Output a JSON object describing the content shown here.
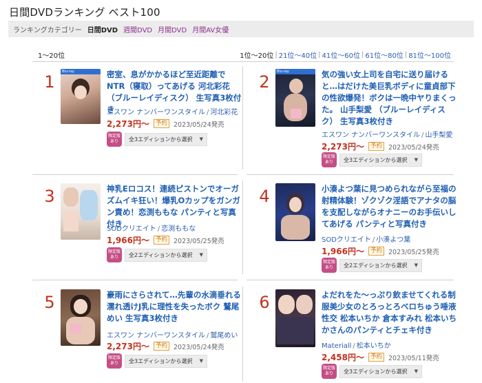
{
  "page": {
    "title": "日間DVDランキング ベスト100"
  },
  "categories": {
    "label": "ランキングカテゴリー",
    "active": "日間DVD",
    "links": [
      "週間DVD",
      "月間DVD",
      "月間AV女優"
    ]
  },
  "range": {
    "current": "1〜20位",
    "active": "1位〜20位",
    "links": [
      "21位〜40位",
      "41位〜60位",
      "61位〜80位",
      "81位〜100位"
    ]
  },
  "items": [
    {
      "rank": "1",
      "title": "密室、息がかかるほど至近距離でNTR（寝取）ってあげる 河北彩花 （ブルーレイディスク） 生写真3枚付き",
      "maker": "エスワン ナンバーワンスタイル",
      "actress": "河北彩花",
      "price": "2,273円〜",
      "yoyaku": "予約",
      "date": "2023/05/24発売",
      "badge": "限定版あり",
      "edition": "全3エディションから選択"
    },
    {
      "rank": "2",
      "title": "気の強い女上司を自宅に送り届けると…はだけた美巨乳ボディに童貞部下の性欲爆発！ボクは一晩中ヤりまくった。 山手梨愛 （ブルーレイディスク） 生写真3枚付き",
      "maker": "エスワン ナンバーワンスタイル",
      "actress": "山手梨愛",
      "price": "2,273円〜",
      "yoyaku": "予約",
      "date": "2023/05/24発売",
      "badge": "限定版あり",
      "edition": "全3エディションから選択"
    },
    {
      "rank": "3",
      "title": "神乳Eロコス！連続ピストンでオーガズムイキ狂い！爆乳Oカップをガンガン責め！恋渕ももな パンティと写真付き",
      "maker": "SODクリエイト",
      "actress": "恋渕ももな",
      "price": "1,966円〜",
      "yoyaku": "予約",
      "date": "2023/05/25発売",
      "badge": "限定版あり",
      "edition": "全2エディションから選択"
    },
    {
      "rank": "4",
      "title": "小湊よつ葉に見つめられながら至福の射精体験！ゾクゾク淫語でアナタの脳を支配しながらオナニーのお手伝いしてあげる パンティと写真付き",
      "maker": "SODクリエイト",
      "actress": "小湊よつ葉",
      "price": "1,966円〜",
      "yoyaku": "予約",
      "date": "2023/05/25発売",
      "badge": "限定版あり",
      "edition": "全2エディションから選択"
    },
    {
      "rank": "5",
      "title": "豪雨にさらされて…先輩の水滴垂れる濡れ透けJ乳に理性を失ったボク 鷲尾めい 生写真3枚付き",
      "maker": "エスワン ナンバーワンスタイル",
      "actress": "鷲尾めい",
      "price": "2,273円〜",
      "yoyaku": "予約",
      "date": "2023/05/24発売",
      "badge": "限定版あり",
      "edition": "全3エディションから選択"
    },
    {
      "rank": "6",
      "title": "よだれをた〜っぷり飲ませてくれる制服美少女のとろっとろベロちゅう唾液性交 松本いちか 倉本すみれ 松本いちかさんのパンティとチェキ付き",
      "maker": "Materiall",
      "actress": "松本いちか",
      "price": "2,458円〜",
      "yoyaku": "予約",
      "date": "2023/05/11発売",
      "badge": "限定版あり",
      "edition": "全3エディションから選択"
    }
  ],
  "colors": {
    "rank": "#c4301c",
    "title_link": "#1f5fb3",
    "category_link": "#8e2d8e",
    "badge": "#c44e86"
  }
}
